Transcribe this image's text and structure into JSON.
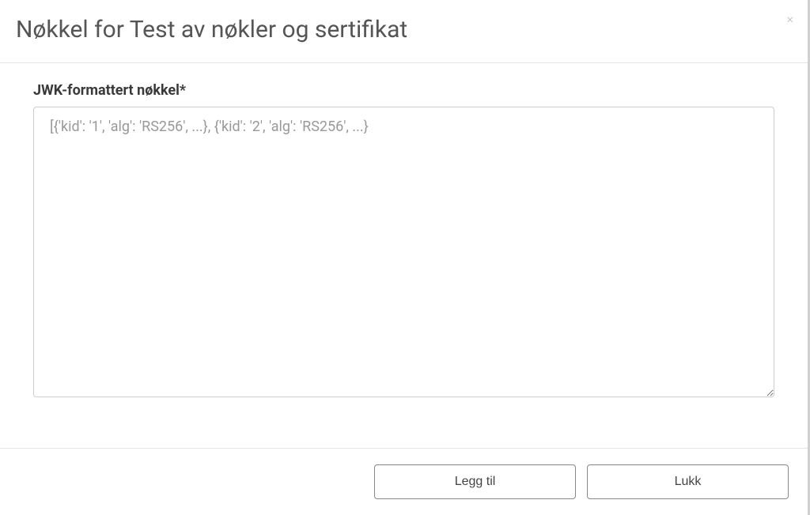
{
  "modal": {
    "title": "Nøkkel for Test av nøkler og sertifikat",
    "close_label": "×"
  },
  "form": {
    "jwk_label": "JWK-formattert nøkkel*",
    "jwk_placeholder": "[{'kid': '1', 'alg': 'RS256', ...}, {'kid': '2', 'alg': 'RS256', ...}",
    "jwk_value": ""
  },
  "footer": {
    "add_label": "Legg til",
    "close_label": "Lukk"
  }
}
